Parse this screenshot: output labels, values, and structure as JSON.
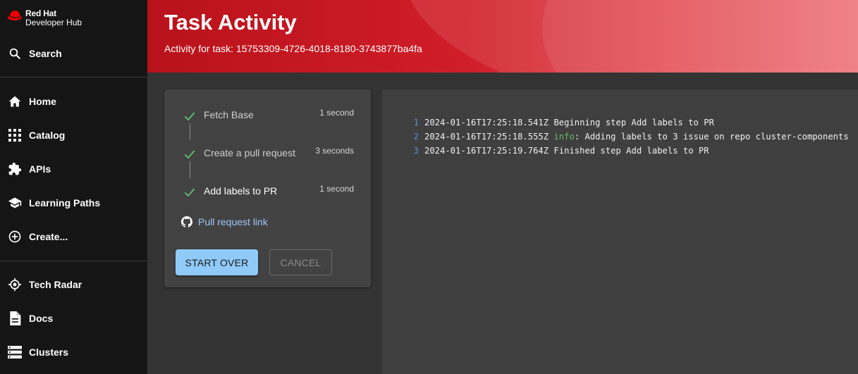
{
  "sidebar": {
    "brand_line1": "Red Hat",
    "brand_line2": "Developer Hub",
    "search_label": "Search",
    "items": [
      {
        "label": "Home",
        "icon": "home-icon"
      },
      {
        "label": "Catalog",
        "icon": "grid-icon"
      },
      {
        "label": "APIs",
        "icon": "puzzle-icon"
      },
      {
        "label": "Learning Paths",
        "icon": "school-icon"
      },
      {
        "label": "Create...",
        "icon": "plus-circle-icon"
      }
    ],
    "items2": [
      {
        "label": "Tech Radar",
        "icon": "radar-icon"
      },
      {
        "label": "Docs",
        "icon": "document-icon"
      },
      {
        "label": "Clusters",
        "icon": "storage-icon"
      }
    ]
  },
  "header": {
    "title": "Task Activity",
    "subtitle": "Activity for task: 15753309-4726-4018-8180-3743877ba4fa"
  },
  "steps": [
    {
      "name": "Fetch Base",
      "duration": "1 second",
      "status": "completed"
    },
    {
      "name": "Create a pull request",
      "duration": "3 seconds",
      "status": "completed"
    },
    {
      "name": "Add labels to PR",
      "duration": "1 second",
      "status": "completed"
    }
  ],
  "links": {
    "pull_request_label": "Pull request link"
  },
  "actions": {
    "start_over": "START OVER",
    "cancel": "CANCEL"
  },
  "log": [
    {
      "num": "1",
      "timestamp": "2024-01-16T17:25:18.541Z",
      "level": "",
      "message": " Beginning step Add labels to PR"
    },
    {
      "num": "2",
      "timestamp": "2024-01-16T17:25:18.555Z",
      "level": "info",
      "message": ": Adding labels to 3 issue on repo cluster-components"
    },
    {
      "num": "3",
      "timestamp": "2024-01-16T17:25:19.764Z",
      "level": "",
      "message": " Finished step Add labels to PR"
    }
  ],
  "colors": {
    "accent": "#ee0000",
    "success": "#5fbf6a",
    "primary_button": "#90caf9",
    "link": "#9ec5f7"
  }
}
